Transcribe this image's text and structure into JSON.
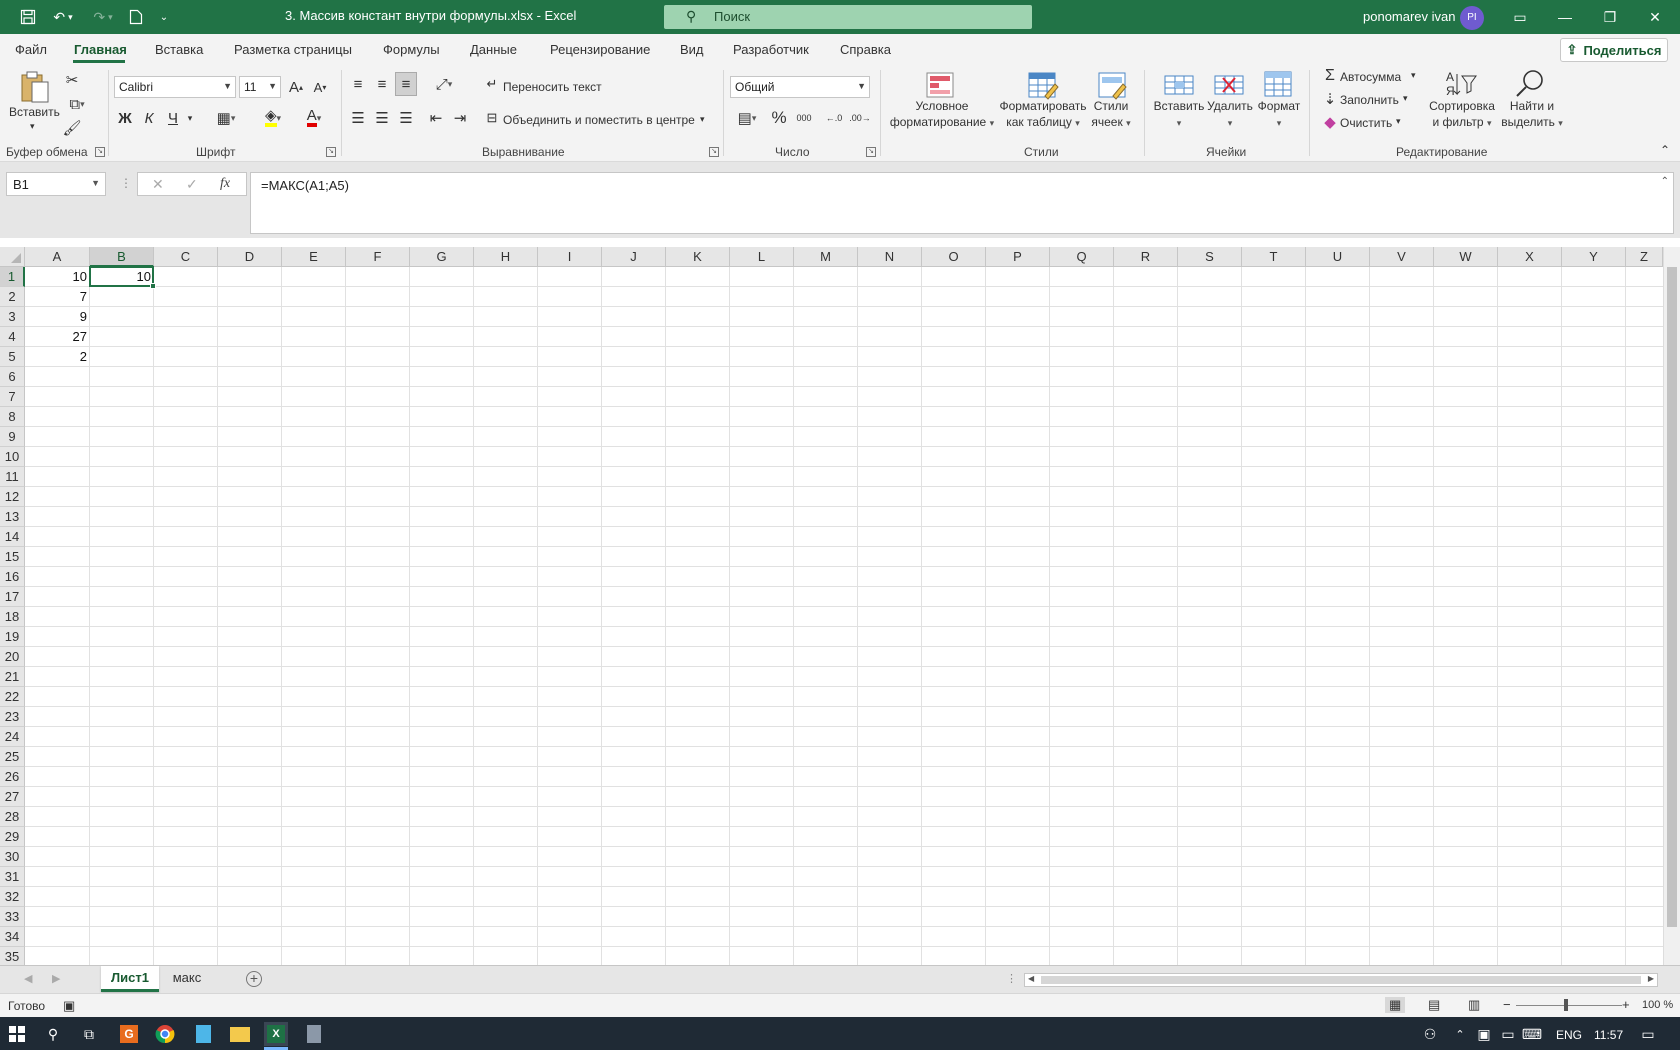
{
  "titlebar": {
    "title": "3. Массив констант внутри формулы.xlsx  -  Excel",
    "search_placeholder": "Поиск",
    "user": "ponomarev ivan",
    "avatar_initials": "PI"
  },
  "menu": {
    "tabs": [
      "Файл",
      "Главная",
      "Вставка",
      "Разметка страницы",
      "Формулы",
      "Данные",
      "Рецензирование",
      "Вид",
      "Разработчик",
      "Справка"
    ],
    "share": "Поделиться"
  },
  "ribbon": {
    "paste": "Вставить",
    "font_name": "Calibri",
    "font_size": "11",
    "bold": "Ж",
    "italic": "К",
    "underline": "Ч",
    "wrap_text": "Переносить текст",
    "merge": "Объединить и поместить в центре",
    "number_format": "Общий",
    "percent": "%",
    "thousands": "000",
    "cond_format_1": "Условное",
    "cond_format_2": "форматирование",
    "format_table_1": "Форматировать",
    "format_table_2": "как таблицу",
    "cell_styles_1": "Стили",
    "cell_styles_2": "ячеек",
    "insert": "Вставить",
    "delete": "Удалить",
    "format": "Формат",
    "autosum": "Автосумма",
    "fill": "Заполнить",
    "clear": "Очистить",
    "sort_1": "Сортировка",
    "sort_2": "и фильтр",
    "find_1": "Найти и",
    "find_2": "выделить",
    "groups": {
      "clipboard": "Буфер обмена",
      "font": "Шрифт",
      "alignment": "Выравнивание",
      "number": "Число",
      "styles": "Стили",
      "cells": "Ячейки",
      "editing": "Редактирование"
    }
  },
  "formula_bar": {
    "name_box": "B1",
    "fx": "fx",
    "formula": "=МАКС(A1;A5)"
  },
  "grid": {
    "columns": [
      "A",
      "B",
      "C",
      "D",
      "E",
      "F",
      "G",
      "H",
      "I",
      "J",
      "K",
      "L",
      "M",
      "N",
      "O",
      "P",
      "Q",
      "R",
      "S",
      "T",
      "U",
      "V",
      "W",
      "X",
      "Y",
      "Z"
    ],
    "rows": [
      "1",
      "2",
      "3",
      "4",
      "5",
      "6",
      "7",
      "8",
      "9",
      "10",
      "11",
      "12",
      "13",
      "14",
      "15",
      "16",
      "17",
      "18",
      "19",
      "20",
      "21",
      "22",
      "23",
      "24",
      "25",
      "26",
      "27",
      "28",
      "29",
      "30",
      "31",
      "32",
      "33",
      "34",
      "35"
    ],
    "selected_cell": "B1",
    "cells": {
      "A1": "10",
      "A2": "7",
      "A3": "9",
      "A4": "27",
      "A5": "2",
      "B1": "10"
    }
  },
  "sheets": {
    "tabs": [
      "Лист1",
      "макс"
    ],
    "active": "Лист1"
  },
  "status": {
    "ready": "Готово",
    "zoom": "100 %"
  },
  "taskbar": {
    "lang": "ENG",
    "time": "11:57"
  }
}
